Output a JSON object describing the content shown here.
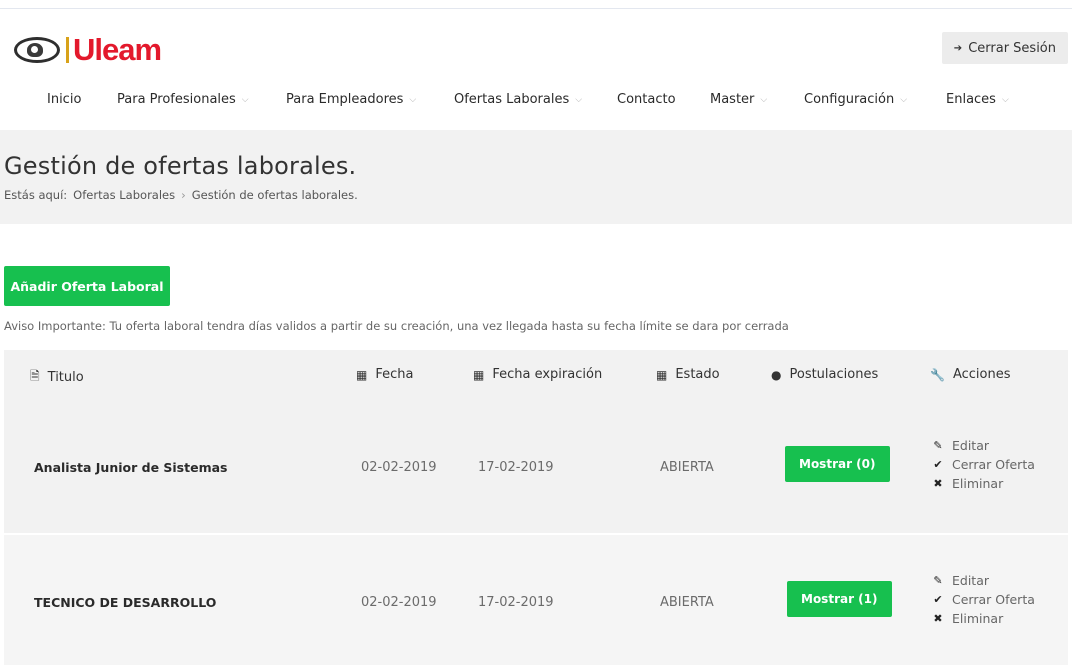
{
  "brand": {
    "logo_text": "Uleam",
    "accent": "#e3192c",
    "seal_bar_color": "#d8a21a"
  },
  "header": {
    "logout_icon": "sign-out-icon",
    "logout_label": "Cerrar Sesión"
  },
  "nav": [
    {
      "label": "Inicio",
      "has_dropdown": false
    },
    {
      "label": "Para Profesionales",
      "has_dropdown": true
    },
    {
      "label": "Para Empleadores",
      "has_dropdown": true
    },
    {
      "label": "Ofertas Laborales",
      "has_dropdown": true
    },
    {
      "label": "Contacto",
      "has_dropdown": false
    },
    {
      "label": "Master",
      "has_dropdown": true
    },
    {
      "label": "Configuración",
      "has_dropdown": true
    },
    {
      "label": "Enlaces",
      "has_dropdown": true
    }
  ],
  "nav_chevron": "⌵",
  "page": {
    "title": "Gestión de ofertas laborales.",
    "breadcrumb": {
      "prefix": "Estás aquí:",
      "parent": "Ofertas Laborales",
      "separator": "›",
      "current": "Gestión de ofertas laborales."
    }
  },
  "add_button_label": "Añadir Oferta Laboral",
  "notice": "Aviso Importante: Tu oferta laboral tendra días validos a partir de su creación, una vez llegada hasta su fecha límite se dara por cerrada",
  "table": {
    "columns": [
      {
        "icon": "file-icon",
        "glyph": "🗎",
        "label": "Titulo"
      },
      {
        "icon": "calendar-icon",
        "glyph": "▦",
        "label": "Fecha"
      },
      {
        "icon": "calendar-icon",
        "glyph": "▦",
        "label": "Fecha expiración"
      },
      {
        "icon": "calendar-icon",
        "glyph": "▦",
        "label": "Estado"
      },
      {
        "icon": "user-icon",
        "glyph": "●",
        "label": "Postulaciones"
      },
      {
        "icon": "wrench-icon",
        "glyph": "🔧",
        "label": "Acciones"
      }
    ],
    "rows": [
      {
        "title": "Analista Junior de Sistemas",
        "date": "02-02-2019",
        "expiration": "17-02-2019",
        "status": "ABIERTA",
        "applications_label": "Mostrar (0)",
        "actions": [
          {
            "icon": "pencil-icon",
            "glyph": "✎",
            "label": "Editar"
          },
          {
            "icon": "check-icon",
            "glyph": "✔",
            "label": "Cerrar Oferta"
          },
          {
            "icon": "times-icon",
            "glyph": "✖",
            "label": "Eliminar"
          }
        ]
      },
      {
        "title": "TECNICO DE DESARROLLO",
        "date": "02-02-2019",
        "expiration": "17-02-2019",
        "status": "ABIERTA",
        "applications_label": "Mostrar (1)",
        "actions": [
          {
            "icon": "pencil-icon",
            "glyph": "✎",
            "label": "Editar"
          },
          {
            "icon": "check-icon",
            "glyph": "✔",
            "label": "Cerrar Oferta"
          },
          {
            "icon": "times-icon",
            "glyph": "✖",
            "label": "Eliminar"
          }
        ]
      }
    ]
  },
  "colors": {
    "primary_green": "#17c04f",
    "band_gray": "#f2f2f2"
  }
}
